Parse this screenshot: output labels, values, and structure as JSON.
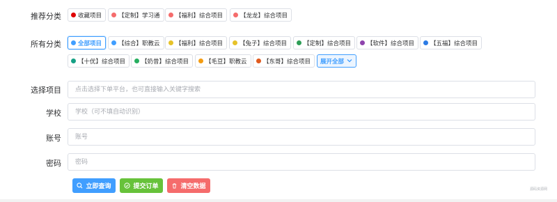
{
  "recommended": {
    "label": "推荐分类",
    "tags": [
      {
        "label": "收藏项目",
        "color": "#e00000"
      },
      {
        "label": "【定制】学习通",
        "color": "#f56c6c"
      },
      {
        "label": "【福利】综合项目",
        "color": "#f56c6c"
      },
      {
        "label": "【龙龙】综合项目",
        "color": "#f56c6c"
      }
    ]
  },
  "all_categories": {
    "label": "所有分类",
    "tags": [
      {
        "label": "全部项目",
        "color": "#409eff",
        "active": true
      },
      {
        "label": "【综合】职教云",
        "color": "#409eff"
      },
      {
        "label": "【福利】综合项目",
        "color": "#e6c229"
      },
      {
        "label": "【兔子】综合项目",
        "color": "#e6c229"
      },
      {
        "label": "【定制】综合项目",
        "color": "#2e9e57"
      },
      {
        "label": "【软件】综合项目",
        "color": "#8e44ad"
      },
      {
        "label": "【五福】综合项目",
        "color": "#2c7be5"
      },
      {
        "label": "【十优】综合项目",
        "color": "#16a085"
      },
      {
        "label": "【奶昔】综合项目",
        "color": "#27ae60"
      },
      {
        "label": "【毛豆】职教云",
        "color": "#f39c12"
      },
      {
        "label": "【东哥】综合项目",
        "color": "#e05a1e"
      }
    ],
    "expand_label": "展开全部"
  },
  "form": {
    "project": {
      "label": "选择项目",
      "placeholder": "点击选择下单平台，也可直接输入关键字搜索"
    },
    "school": {
      "label": "学校",
      "placeholder": "学校（可不填自动识别）"
    },
    "account": {
      "label": "账号",
      "placeholder": "账号"
    },
    "password": {
      "label": "密码",
      "placeholder": "密码"
    }
  },
  "buttons": {
    "query": "立即查询",
    "submit": "提交订单",
    "clear": "清空数据"
  },
  "watermark": "源码资源网"
}
